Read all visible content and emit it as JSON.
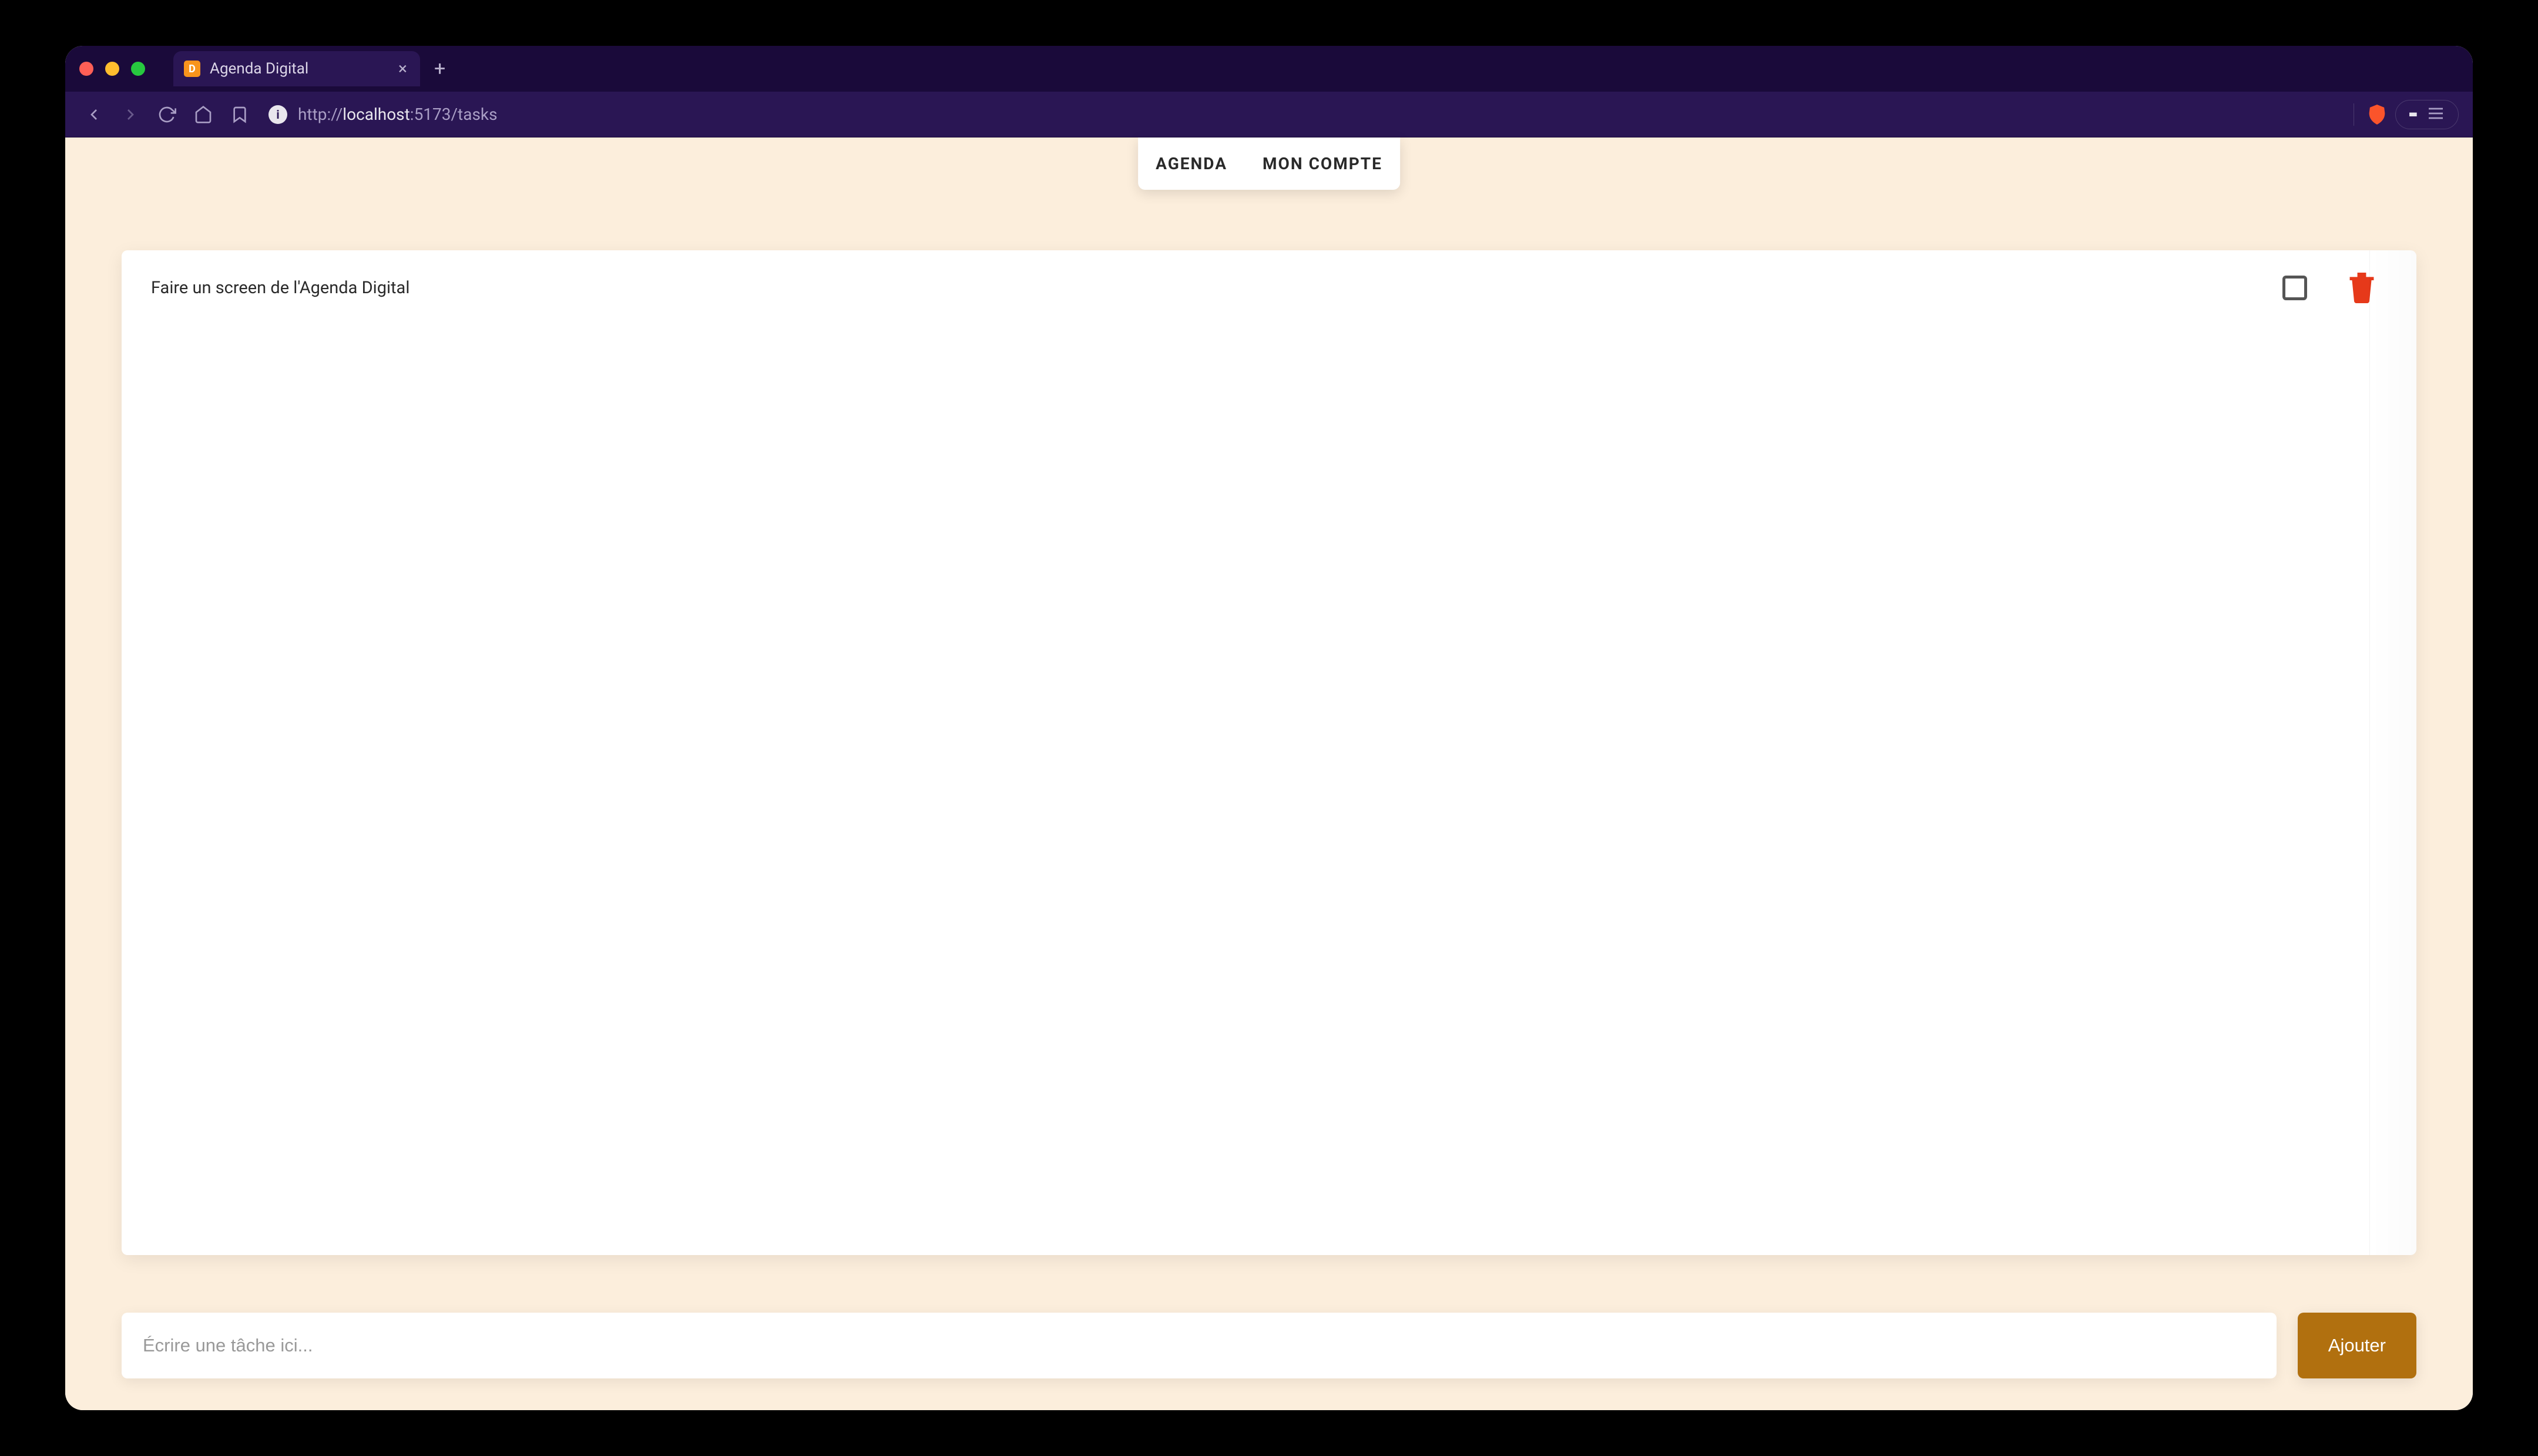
{
  "browser": {
    "tab_title": "Agenda Digital",
    "url_prefix": "http://",
    "url_host": "localhost",
    "url_path": ":5173/tasks"
  },
  "nav": {
    "agenda": "AGENDA",
    "account": "MON COMPTE"
  },
  "tasks": [
    {
      "text": "Faire un screen de l'Agenda Digital"
    }
  ],
  "add": {
    "placeholder": "Écrire une tâche ici...",
    "button": "Ajouter"
  },
  "icons": {
    "favicon": "D",
    "secure": "i"
  }
}
